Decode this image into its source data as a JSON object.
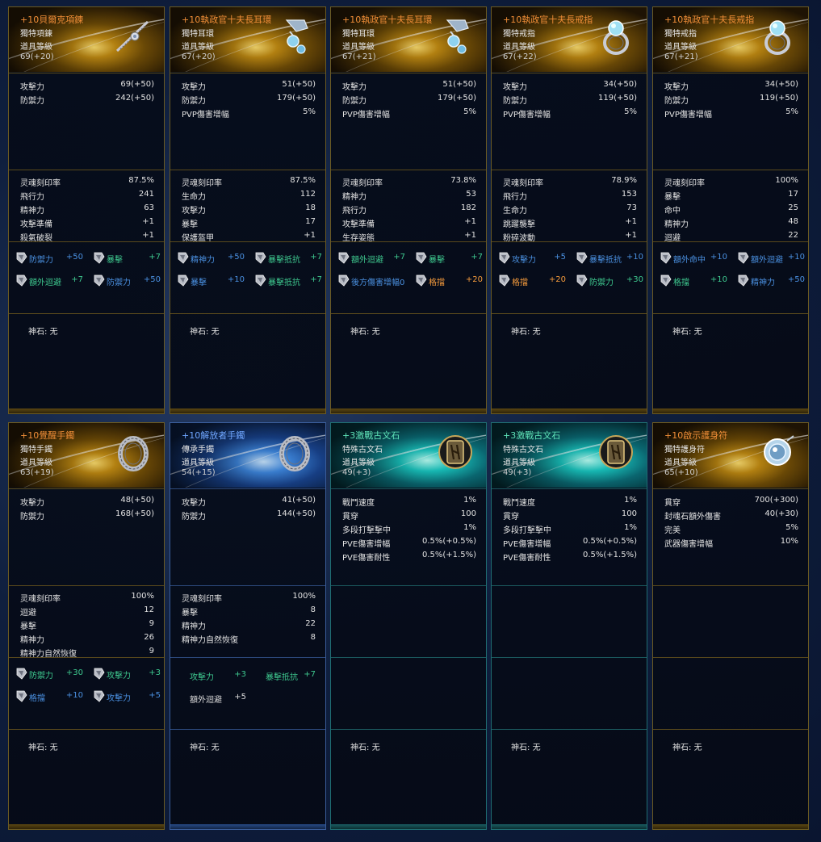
{
  "labels": {
    "godstone_label": "神石:",
    "godstone_value": "无"
  },
  "colors": {
    "gold_frame": "#6b5a22",
    "blue_frame": "#3a5d9a",
    "teal_frame": "#1f6d72",
    "name_orange": "#f08e38",
    "name_blue": "#6fa6ff",
    "name_teal": "#5fe3b8",
    "stat_blue": "#4a90e0",
    "stat_green": "#3ec98f",
    "stat_orange": "#f39a3c"
  },
  "items": [
    {
      "name": "+10貝爾克項鍊",
      "type": "獨特項鍊",
      "level_label": "道具等級",
      "level": "69(+20)",
      "icon": "necklace-icon",
      "base": [
        [
          "攻擊力",
          "69(+50)"
        ],
        [
          "防禦力",
          "242(+50)"
        ]
      ],
      "bonus": [
        [
          "灵魂刻印率",
          "87.5%"
        ],
        [
          "飛行力",
          "241"
        ],
        [
          "精神力",
          "63"
        ],
        [
          "攻擊準備",
          "+1"
        ],
        [
          "殺氣破裂",
          "+1"
        ]
      ],
      "gems": [
        [
          "防禦力",
          "+50",
          "blue"
        ],
        [
          "暴擊",
          "+7",
          "green"
        ],
        [
          "額外迴避",
          "+7",
          "green"
        ],
        [
          "防禦力",
          "+50",
          "blue"
        ]
      ]
    },
    {
      "name": "+10執政官十夫長耳環",
      "type": "獨特耳環",
      "level_label": "道具等級",
      "level": "67(+20)",
      "icon": "earring-icon",
      "base": [
        [
          "攻擊力",
          "51(+50)"
        ],
        [
          "防禦力",
          "179(+50)"
        ],
        [
          "PVP傷害增幅",
          "5%"
        ]
      ],
      "bonus": [
        [
          "灵魂刻印率",
          "87.5%"
        ],
        [
          "生命力",
          "112"
        ],
        [
          "攻擊力",
          "18"
        ],
        [
          "暴擊",
          "17"
        ],
        [
          "保護盔甲",
          "+1"
        ]
      ],
      "gems": [
        [
          "精神力",
          "+50",
          "blue"
        ],
        [
          "暴擊抵抗",
          "+7",
          "green"
        ],
        [
          "暴擊",
          "+10",
          "blue"
        ],
        [
          "暴擊抵抗",
          "+7",
          "green"
        ]
      ]
    },
    {
      "name": "+10執政官十夫長耳環",
      "type": "獨特耳環",
      "level_label": "道具等級",
      "level": "67(+21)",
      "icon": "earring-icon",
      "base": [
        [
          "攻擊力",
          "51(+50)"
        ],
        [
          "防禦力",
          "179(+50)"
        ],
        [
          "PVP傷害增幅",
          "5%"
        ]
      ],
      "bonus": [
        [
          "灵魂刻印率",
          "73.8%"
        ],
        [
          "精神力",
          "53"
        ],
        [
          "飛行力",
          "182"
        ],
        [
          "攻擊準備",
          "+1"
        ],
        [
          "生存姿態",
          "+1"
        ]
      ],
      "gems": [
        [
          "額外迴避",
          "+7",
          "green"
        ],
        [
          "暴擊",
          "+7",
          "green"
        ],
        [
          "後方傷害增幅0",
          "",
          "blue"
        ],
        [
          "格擋",
          "+20",
          "orange"
        ]
      ]
    },
    {
      "name": "+10執政官十夫長戒指",
      "type": "獨特戒指",
      "level_label": "道具等級",
      "level": "67(+22)",
      "icon": "ring-icon",
      "base": [
        [
          "攻擊力",
          "34(+50)"
        ],
        [
          "防禦力",
          "119(+50)"
        ],
        [
          "PVP傷害增幅",
          "5%"
        ]
      ],
      "bonus": [
        [
          "灵魂刻印率",
          "78.9%"
        ],
        [
          "飛行力",
          "153"
        ],
        [
          "生命力",
          "73"
        ],
        [
          "跳躍襲擊",
          "+1"
        ],
        [
          "粉碎波動",
          "+1"
        ]
      ],
      "gems": [
        [
          "攻擊力",
          "+5",
          "blue"
        ],
        [
          "暴擊抵抗",
          "+10",
          "blue"
        ],
        [
          "格擋",
          "+20",
          "orange"
        ],
        [
          "防禦力",
          "+30",
          "green"
        ]
      ]
    },
    {
      "name": "+10執政官十夫長戒指",
      "type": "獨特戒指",
      "level_label": "道具等級",
      "level": "67(+21)",
      "icon": "ring-icon",
      "base": [
        [
          "攻擊力",
          "34(+50)"
        ],
        [
          "防禦力",
          "119(+50)"
        ],
        [
          "PVP傷害增幅",
          "5%"
        ]
      ],
      "bonus": [
        [
          "灵魂刻印率",
          "100%"
        ],
        [
          "暴擊",
          "17"
        ],
        [
          "命中",
          "25"
        ],
        [
          "精神力",
          "48"
        ],
        [
          "迴避",
          "22"
        ]
      ],
      "gems": [
        [
          "額外命中",
          "+10",
          "blue"
        ],
        [
          "額外迴避",
          "+10",
          "blue"
        ],
        [
          "格擋",
          "+10",
          "green"
        ],
        [
          "精神力",
          "+50",
          "blue"
        ]
      ]
    },
    {
      "name": "+10覺醒手鐲",
      "type": "獨特手鐲",
      "level_label": "道具等級",
      "level": "63(+19)",
      "icon": "bracelet-icon",
      "base": [
        [
          "攻擊力",
          "48(+50)"
        ],
        [
          "防禦力",
          "168(+50)"
        ]
      ],
      "bonus": [
        [
          "灵魂刻印率",
          "100%"
        ],
        [
          "迴避",
          "12"
        ],
        [
          "暴擊",
          "9"
        ],
        [
          "精神力",
          "26"
        ],
        [
          "精神力自然恢復",
          "9"
        ]
      ],
      "gems": [
        [
          "防禦力",
          "+30",
          "green"
        ],
        [
          "攻擊力",
          "+3",
          "green"
        ],
        [
          "格擋",
          "+10",
          "blue"
        ],
        [
          "攻擊力",
          "+5",
          "blue"
        ]
      ]
    },
    {
      "name": "+10解放者手鐲",
      "type": "傳承手鐲",
      "level_label": "道具等級",
      "level": "54(+15)",
      "icon": "bracelet-icon",
      "base": [
        [
          "攻擊力",
          "41(+50)"
        ],
        [
          "防禦力",
          "144(+50)"
        ]
      ],
      "bonus": [
        [
          "灵魂刻印率",
          "100%"
        ],
        [
          "暴擊",
          "8"
        ],
        [
          "精神力",
          "22"
        ],
        [
          "精神力自然恢復",
          "8"
        ]
      ],
      "gems": [
        [
          "攻擊力",
          "+3",
          "green"
        ],
        [
          "暴擊抵抗",
          "+7",
          "green"
        ],
        [
          "額外迴避",
          "+5",
          "white"
        ]
      ]
    },
    {
      "name": "+3激戰古文石",
      "type": "特殊古文石",
      "level_label": "道具等級",
      "level": "49(+3)",
      "icon": "rune-stone-icon",
      "base": [
        [
          "戰鬥速度",
          "1%"
        ],
        [
          "貫穿",
          "100"
        ],
        [
          "多段打擊擊中",
          "1%"
        ],
        [
          "PVE傷害增幅",
          "0.5%(+0.5%)"
        ],
        [
          "PVE傷害耐性",
          "0.5%(+1.5%)"
        ]
      ],
      "bonus": [],
      "gems": []
    },
    {
      "name": "+3激戰古文石",
      "type": "特殊古文石",
      "level_label": "道具等級",
      "level": "49(+3)",
      "icon": "rune-stone-icon",
      "base": [
        [
          "戰鬥速度",
          "1%"
        ],
        [
          "貫穿",
          "100"
        ],
        [
          "多段打擊擊中",
          "1%"
        ],
        [
          "PVE傷害增幅",
          "0.5%(+0.5%)"
        ],
        [
          "PVE傷害耐性",
          "0.5%(+1.5%)"
        ]
      ],
      "bonus": [],
      "gems": []
    },
    {
      "name": "+10啟示護身符",
      "type": "獨特護身符",
      "level_label": "道具等級",
      "level": "65(+10)",
      "icon": "amulet-icon",
      "base": [
        [
          "貫穿",
          "700(+300)"
        ],
        [
          "封魂石額外傷害",
          "40(+30)"
        ],
        [
          "完美",
          "5%"
        ],
        [
          "武器傷害增幅",
          "10%"
        ]
      ],
      "bonus": [],
      "gems": []
    }
  ]
}
